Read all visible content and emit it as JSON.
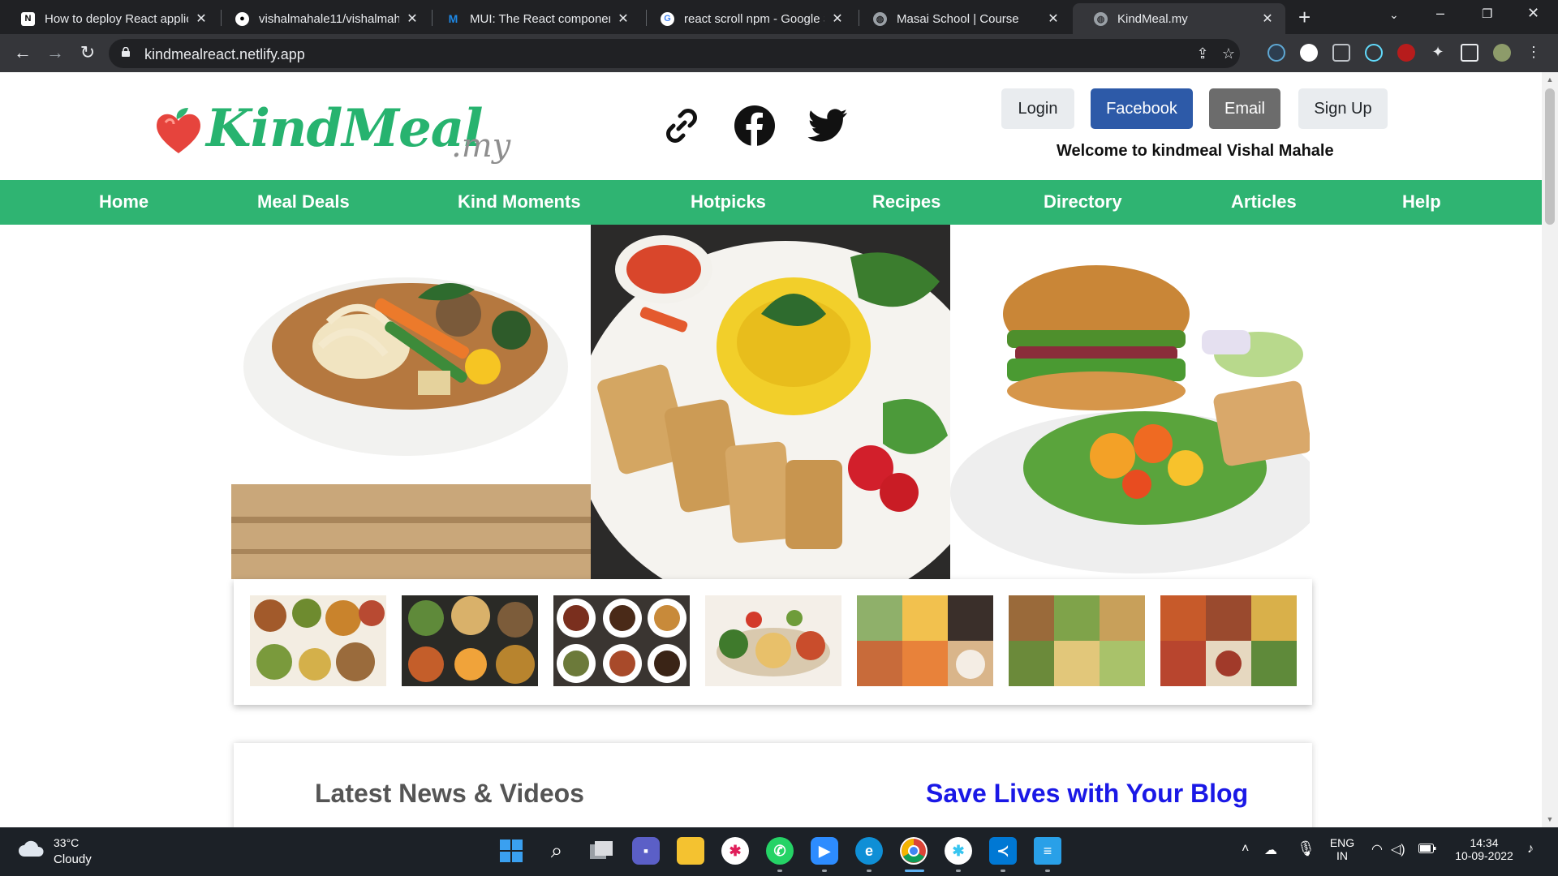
{
  "browser": {
    "tabs": [
      {
        "title": "How to deploy React applic",
        "icon": "notion-icon",
        "active": false
      },
      {
        "title": "vishalmahale11/vishalmaha",
        "icon": "github-icon",
        "active": false
      },
      {
        "title": "MUI: The React component",
        "icon": "mui-icon",
        "active": false
      },
      {
        "title": "react scroll npm - Google S",
        "icon": "google-icon",
        "active": false
      },
      {
        "title": "Masai School | Course",
        "icon": "globe-icon",
        "active": false
      },
      {
        "title": "KindMeal.my",
        "icon": "globe-icon",
        "active": true
      }
    ],
    "url": "kindmealreact.netlify.app"
  },
  "header": {
    "logo_main": "KindMeal",
    "logo_suffix": ".my",
    "social_icons": [
      "link-icon",
      "facebook-icon",
      "twitter-icon"
    ],
    "buttons": {
      "login": "Login",
      "facebook": "Facebook",
      "email": "Email",
      "signup": "Sign Up"
    },
    "welcome": "Welcome to kindmeal Vishal Mahale"
  },
  "nav": {
    "items": [
      "Home",
      "Meal Deals",
      "Kind Moments",
      "Hotpicks",
      "Recipes",
      "Directory",
      "Articles",
      "Help"
    ]
  },
  "sections": {
    "news_title": "Latest News & Videos",
    "blog_title": "Save Lives with Your Blog"
  },
  "colors": {
    "brand_green": "#2fb472",
    "facebook_blue": "#2d5aa8",
    "blog_blue": "#1a18e6"
  },
  "taskbar": {
    "weather_temp": "33°C",
    "weather_cond": "Cloudy",
    "lang_top": "ENG",
    "lang_bottom": "IN",
    "time": "14:34",
    "date": "10-09-2022"
  }
}
